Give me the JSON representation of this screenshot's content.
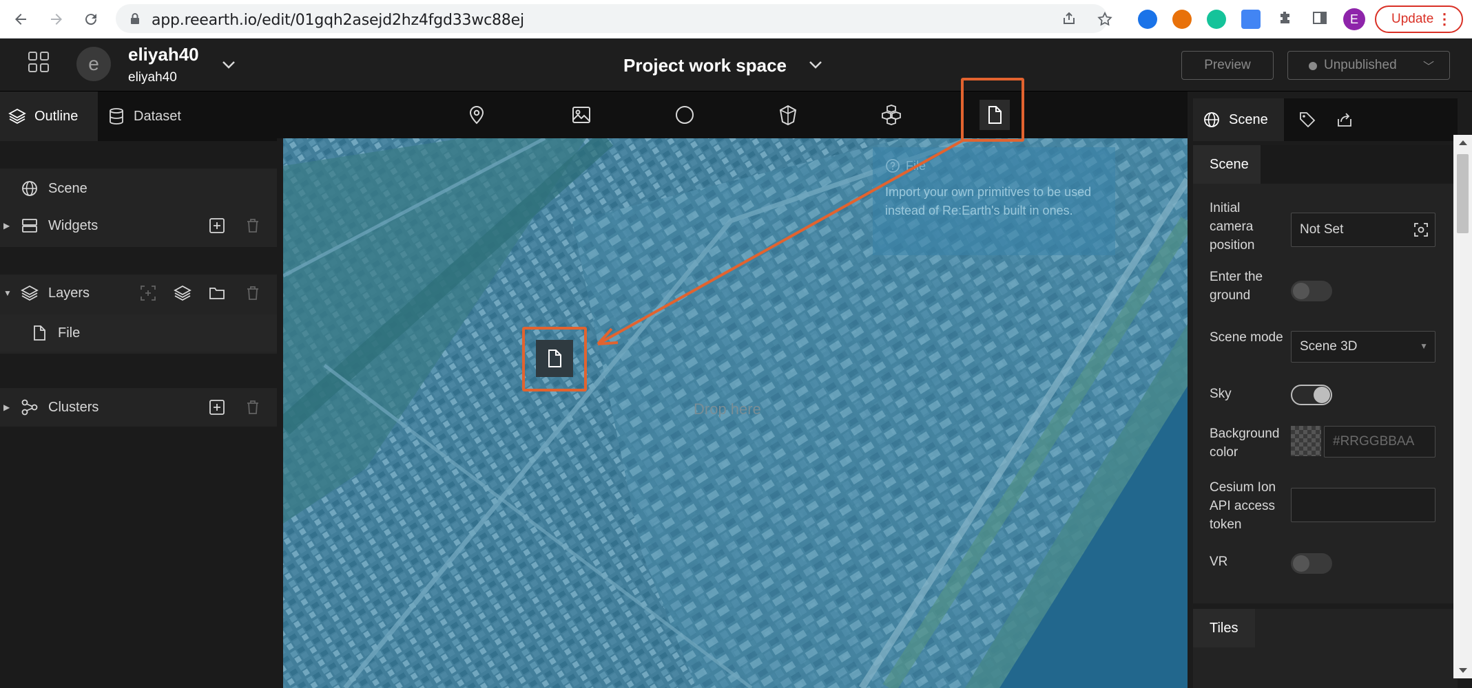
{
  "browser": {
    "url": "app.reearth.io/edit/01gqh2asejd2hz4fgd33wc88ej",
    "update_label": "Update",
    "profile_initial": "E"
  },
  "header": {
    "avatar_letter": "e",
    "user_name": "eliyah40",
    "user_sub": "eliyah40",
    "project_title": "Project work space",
    "preview_label": "Preview",
    "publish_label": "Unpublished"
  },
  "left": {
    "tabs": [
      {
        "label": "Outline",
        "icon": "layers-icon"
      },
      {
        "label": "Dataset",
        "icon": "database-icon"
      }
    ],
    "scene_label": "Scene",
    "widgets_label": "Widgets",
    "layers_label": "Layers",
    "file_label": "File",
    "clusters_label": "Clusters"
  },
  "toolbar": {
    "tools": [
      "marker-icon",
      "image-icon",
      "circle-icon",
      "polygon-icon",
      "model-icon",
      "file-icon"
    ]
  },
  "map": {
    "drop_text": "Drop here"
  },
  "tooltip": {
    "title": "File",
    "body": "Import your own primitives to be used instead of Re:Earth's built in ones."
  },
  "right": {
    "tabs": [
      {
        "label": "Scene",
        "icon": "globe-icon"
      },
      {
        "label": "",
        "icon": "tag-icon"
      },
      {
        "label": "",
        "icon": "export-icon"
      }
    ],
    "scene_section": "Scene",
    "camera_label": "Initial camera position",
    "camera_value": "Not Set",
    "ground_label": "Enter the ground",
    "ground_on": false,
    "mode_label": "Scene mode",
    "mode_value": "Scene 3D",
    "sky_label": "Sky",
    "sky_on": true,
    "bg_label": "Background color",
    "bg_placeholder": "#RRGGBBAA",
    "token_label": "Cesium Ion API access token",
    "token_value": "",
    "vr_label": "VR",
    "vr_on": false,
    "tiles_section": "Tiles"
  },
  "colors": {
    "highlight": "#e2632f",
    "map_tint": "#2f7ea3",
    "panel_bg": "#1b1b1b"
  }
}
